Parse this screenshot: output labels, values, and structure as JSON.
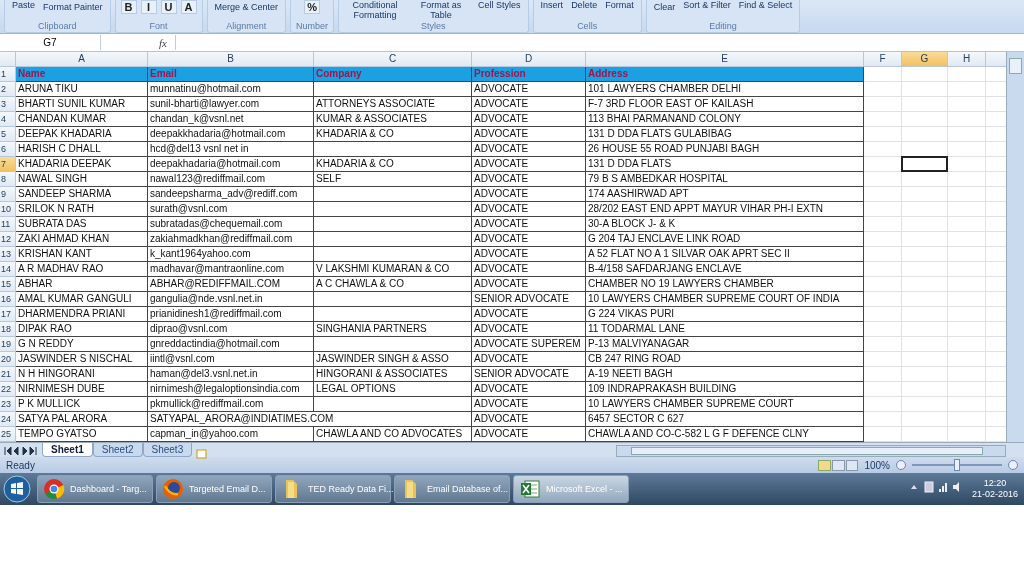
{
  "ribbon": {
    "groups": [
      {
        "label": "Clipboard",
        "items": [
          {
            "kind": "big",
            "text": "Paste"
          },
          {
            "kind": "small",
            "text": "Format Painter"
          }
        ]
      },
      {
        "label": "Font",
        "items": [
          {
            "kind": "glyph",
            "text": "B"
          },
          {
            "kind": "glyph",
            "text": "I"
          },
          {
            "kind": "glyph",
            "text": "U"
          },
          {
            "kind": "glyph",
            "text": "A"
          }
        ]
      },
      {
        "label": "Alignment",
        "items": [
          {
            "kind": "small",
            "text": "Merge & Center"
          }
        ]
      },
      {
        "label": "Number",
        "items": [
          {
            "kind": "glyph",
            "text": "%"
          }
        ]
      },
      {
        "label": "Styles",
        "items": [
          {
            "kind": "big",
            "text": "Conditional Formatting"
          },
          {
            "kind": "big",
            "text": "Format as Table"
          },
          {
            "kind": "big",
            "text": "Cell Styles"
          }
        ]
      },
      {
        "label": "Cells",
        "items": [
          {
            "kind": "big",
            "text": "Insert"
          },
          {
            "kind": "big",
            "text": "Delete"
          },
          {
            "kind": "big",
            "text": "Format"
          }
        ]
      },
      {
        "label": "Editing",
        "items": [
          {
            "kind": "small",
            "text": "Clear"
          },
          {
            "kind": "big",
            "text": "Sort & Filter"
          },
          {
            "kind": "big",
            "text": "Find & Select"
          }
        ]
      }
    ]
  },
  "formula_bar": {
    "name_box": "G7",
    "fx_label": "fx"
  },
  "columns": [
    {
      "letter": "A",
      "selected": false
    },
    {
      "letter": "B",
      "selected": false
    },
    {
      "letter": "C",
      "selected": false
    },
    {
      "letter": "D",
      "selected": false
    },
    {
      "letter": "E",
      "selected": false
    },
    {
      "letter": "F",
      "selected": false
    },
    {
      "letter": "G",
      "selected": true
    },
    {
      "letter": "H",
      "selected": false
    }
  ],
  "header_row": {
    "number": "1",
    "selected": false,
    "titles": [
      "Name",
      "Email",
      "Company",
      "Profession",
      "Address"
    ]
  },
  "rows": [
    {
      "number": "2",
      "selected": false,
      "name": "ARUNA TIKU",
      "email": "munnatinu@hotmail.com",
      "profession": "ADVOCATE",
      "address": "101 LAWYERS CHAMBER DELHI"
    },
    {
      "number": "3",
      "selected": false,
      "name": "BHARTI SUNIL KUMAR",
      "email": "sunil-bharti@lawyer.com",
      "company": "ATTORNEYS ASSOCIATE",
      "profession": "ADVOCATE",
      "address": "F-7 3RD FLOOR EAST OF KAILASH"
    },
    {
      "number": "4",
      "selected": false,
      "name": "CHANDAN KUMAR",
      "email": "chandan_k@vsnl.net",
      "company": "KUMAR & ASSOCIATES",
      "profession": "ADVOCATE",
      "address": "113 BHAI PARMANAND COLONY"
    },
    {
      "number": "5",
      "selected": false,
      "name": "DEEPAK KHADARIA",
      "email": "deepakkhadaria@hotmail.com",
      "company": "KHADARIA & CO",
      "profession": "ADVOCATE",
      "address": "131 D DDA FLATS GULABIBAG"
    },
    {
      "number": "6",
      "selected": false,
      "name": "HARISH C DHALL",
      "email": "hcd@del13 vsnl net in",
      "profession": "ADVOCATE",
      "address": "26 HOUSE 55 ROAD PUNJABI BAGH"
    },
    {
      "number": "7",
      "selected": true,
      "name": "KHADARIA DEEPAK",
      "email": "deepakhadaria@hotmail.com",
      "company": "KHADARIA & CO",
      "profession": "ADVOCATE",
      "address": "131 D DDA FLATS"
    },
    {
      "number": "8",
      "selected": false,
      "name": "NAWAL SINGH",
      "email": "nawal123@rediffmail.com",
      "company": "SELF",
      "profession": "ADVOCATE",
      "address": "79 B S AMBEDKAR HOSPITAL"
    },
    {
      "number": "9",
      "selected": false,
      "name": "SANDEEP SHARMA",
      "email": "sandeepsharma_adv@rediff.com",
      "profession": "ADVOCATE",
      "address": "174 AASHIRWAD APT"
    },
    {
      "number": "10",
      "selected": false,
      "name": "SRILOK N RATH",
      "email": "surath@vsnl.com",
      "profession": "ADVOCATE",
      "address": "28/202 EAST END APPT MAYUR VIHAR PH-I EXTN"
    },
    {
      "number": "11",
      "selected": false,
      "name": "SUBRATA DAS",
      "email": "subratadas@chequemail.com",
      "profession": "ADVOCATE",
      "address": "30-A BLOCK J- & K"
    },
    {
      "number": "12",
      "selected": false,
      "name": "ZAKI AHMAD KHAN",
      "email": "zakiahmadkhan@rediffmail.com",
      "profession": "ADVOCATE",
      "address": "G 204 TAJ ENCLAVE LINK ROAD"
    },
    {
      "number": "13",
      "selected": false,
      "name": "KRISHAN KANT",
      "email": "k_kant1964yahoo.com",
      "profession": "ADVOCATE",
      "address": "A 52 FLAT NO A 1 SILVAR OAK APRT SEC II"
    },
    {
      "number": "14",
      "selected": false,
      "name": "A R MADHAV RAO",
      "email": "madhavar@mantraonline.com",
      "company": "V LAKSHMI KUMARAN & CO",
      "profession": "ADVOCATE",
      "address": "B-4/158 SAFDARJANG ENCLAVE"
    },
    {
      "number": "15",
      "selected": false,
      "name": "ABHAR",
      "email": "ABHAR@REDIFFMAIL.COM",
      "company": "A C CHAWLA & CO",
      "profession": "ADVOCATE",
      "address": "CHAMBER NO 19 LAWYERS CHAMBER"
    },
    {
      "number": "16",
      "selected": false,
      "name": "AMAL KUMAR GANGULI",
      "email": "gangulia@nde.vsnl.net.in",
      "profession": "SENIOR ADVOCATE",
      "address": "10 LAWYERS CHAMBER SUPREME COURT OF INDIA"
    },
    {
      "number": "17",
      "selected": false,
      "name": "DHARMENDRA PRIANI",
      "email": "prianidinesh1@rediffmail.com",
      "profession": "ADVOCATE",
      "address": "G 224 VIKAS PURI"
    },
    {
      "number": "18",
      "selected": false,
      "name": "DIPAK RAO",
      "email": "diprao@vsnl.com",
      "company": "SINGHANIA PARTNERS",
      "profession": "ADVOCATE",
      "address": "11 TODARMAL LANE"
    },
    {
      "number": "19",
      "selected": false,
      "name": "G N REDDY",
      "email": "gnreddactindia@hotmail.com",
      "profession": "ADVOCATE SUPEREM",
      "address": "P-13 MALVIYANAGAR"
    },
    {
      "number": "20",
      "selected": false,
      "name": "JASWINDER S NISCHAL",
      "email": "iintl@vsnl.com",
      "company": "JASWINDER SINGH & ASSO",
      "profession": "ADVOCATE",
      "address": "CB 247 RING ROAD"
    },
    {
      "number": "21",
      "selected": false,
      "name": "N H HINGORANI",
      "email": "haman@del3.vsnl.net.in",
      "company": "HINGORANI & ASSOCIATES",
      "profession": "SENIOR ADVOCATE",
      "address": "A-19 NEETI BAGH"
    },
    {
      "number": "22",
      "selected": false,
      "name": "NIRNIMESH DUBE",
      "email": "nirnimesh@legaloptionsindia.com",
      "company": "LEGAL OPTIONS",
      "profession": "ADVOCATE",
      "address": "109 INDRAPRAKASH BUILDING"
    },
    {
      "number": "23",
      "selected": false,
      "name": "P K MULLICK",
      "email": "pkmullick@rediffmail.com",
      "profession": "ADVOCATE",
      "address": "10 LAWYERS CHAMBER SUPREME COURT"
    },
    {
      "number": "24",
      "selected": false,
      "name": "SATYA PAL ARORA",
      "email": "SATYAPAL_ARORA@INDIATIMES.COM",
      "email_overflow": true,
      "profession": "ADVOCATE",
      "address": "6457 SECTOR C 627"
    },
    {
      "number": "25",
      "selected": false,
      "name": "TEMPO GYATSO",
      "email": "capman_in@yahoo.com",
      "company": "CHAWLA AND CO ADVOCATES",
      "profession": "ADVOCATE",
      "address": "CHAWLA AND CO-C-582 L G F DEFENCE CLNY"
    }
  ],
  "sheet_tabs": [
    {
      "label": "Sheet1",
      "selected": true
    },
    {
      "label": "Sheet2",
      "selected": false
    },
    {
      "label": "Sheet3",
      "selected": false
    }
  ],
  "status_bar": {
    "status": "Ready",
    "zoom": "100%",
    "zoom_slider": {
      "level": 0.5
    }
  },
  "taskbar": {
    "items": [
      {
        "kind": "chrome",
        "label": "Dashboard - Targ...",
        "selected": false
      },
      {
        "kind": "firefox",
        "label": "Targeted Email D...",
        "selected": false
      },
      {
        "kind": "folder",
        "label": "TED Ready Data Fi...",
        "selected": false
      },
      {
        "kind": "folder",
        "label": "Email Database of...",
        "selected": false
      },
      {
        "kind": "excel",
        "label": "Microsoft Excel - ...",
        "selected": true
      }
    ],
    "clock": {
      "time": "12:20",
      "date": "21-02-2016"
    }
  }
}
